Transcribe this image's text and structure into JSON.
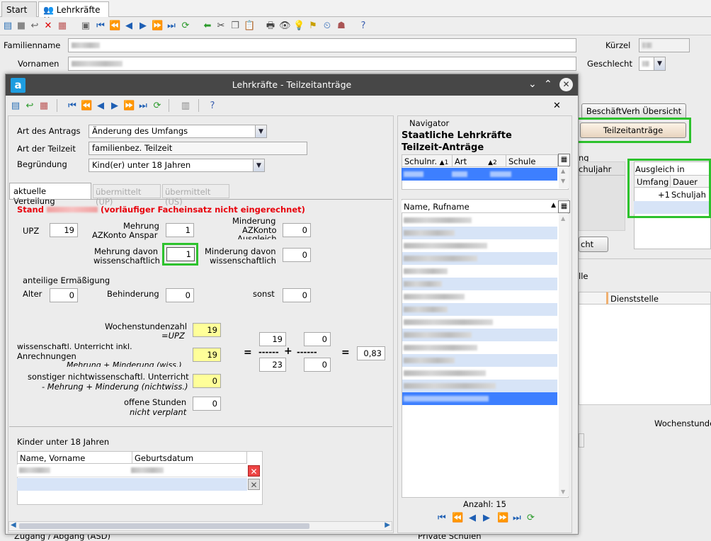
{
  "tabs": {
    "start": "Start",
    "lehrkraefte": "Lehrkräfte",
    "close": "✕"
  },
  "main": {
    "familienname_label": "Familienname",
    "vornamen_label": "Vornamen",
    "kuerzel_label": "Kürzel",
    "geschlecht_label": "Geschlecht",
    "beschaeft_button": "BeschäftVerh Übersicht",
    "teilzeit_button": "Teilzeitanträge",
    "ausgleich_header": "Ausgleich in diesem",
    "umfang_col": "Umfang",
    "dauer_col": "Dauer",
    "ausgleich_value": "+1",
    "ausgleich_dauer": "Schuljah",
    "schuljahr_label": "chuljahr",
    "g_label": "ng",
    "cht_button": "cht",
    "lle_label": "lle",
    "dienststelle_col": "Dienststelle",
    "wochenstunden_label": "Wochenstunde",
    "zugang_label": "Zugang / Abgang (ASD)",
    "private_label": "Private Schulen"
  },
  "dialog": {
    "title": "Lehrkräfte - Teilzeitanträge",
    "logo": "a",
    "art_antrag_label": "Art des Antrags",
    "art_antrag_value": "Änderung des Umfangs",
    "art_teilzeit_label": "Art der Teilzeit",
    "art_teilzeit_value": "familienbez. Teilzeit",
    "begruendung_label": "Begründung",
    "begruendung_value": "Kind(er) unter 18 Jahren",
    "tab_aktuell": "aktuelle Verteilung",
    "tab_up": "übermittelt (UP)",
    "tab_us": "übermittelt (US)",
    "stand_label": "Stand",
    "stand_note": "(vorläufiger Facheinsatz nicht eingerechnet)",
    "upz_label": "UPZ",
    "upz_value": "19",
    "mehrung_azkonto_label1": "Mehrung",
    "mehrung_azkonto_label2": "AZKonto Anspar",
    "mehrung_azkonto_value": "1",
    "minderung_azkonto_label1": "Minderung",
    "minderung_azkonto_label2": "AZKonto",
    "minderung_azkonto_label3": "Ausgleich",
    "minderung_azkonto_value": "0",
    "mehrung_wiss_label1": "Mehrung davon",
    "mehrung_wiss_label2": "wissenschaftlich",
    "mehrung_wiss_value": "1",
    "minderung_wiss_label1": "Minderung davon",
    "minderung_wiss_label2": "wissenschaftlich",
    "minderung_wiss_value": "0",
    "anteilige_label": "anteilige Ermäßigung",
    "alter_label": "Alter",
    "alter_value": "0",
    "behinderung_label": "Behinderung",
    "behinderung_value": "0",
    "sonst_label": "sonst",
    "sonst_value": "0",
    "wochenstunden_label": "Wochenstundenzahl",
    "wochenstunden_sub": "=UPZ",
    "wochenstunden_value": "19",
    "wiss_unterricht_label1": "wissenschaftl. Unterricht inkl.",
    "wiss_unterricht_label2": "Anrechnungen",
    "wiss_unterricht_label3": "Mehrung + Minderung (wiss.)",
    "wiss_unterricht_value": "19",
    "sonst_unterricht_label1": "sonstiger nichtwissenschaftl. Unterricht",
    "sonst_unterricht_label2": "- Mehrung + Minderung (nichtwiss.)",
    "sonst_unterricht_value": "0",
    "offene_label1": "offene Stunden",
    "offene_label2": "nicht verplant",
    "offene_value": "0",
    "calc_top1": "19",
    "calc_top2": "0",
    "calc_bottom1": "23",
    "calc_bottom2": "0",
    "calc_result": "0,83",
    "calc_eq": "=",
    "calc_dash": "------",
    "calc_plus": "+",
    "calc_eq2": "=",
    "kinder_label": "Kinder unter 18 Jahren",
    "kinder_col1": "Name, Vorname",
    "kinder_col2": "Geburtsdatum",
    "navigator_label": "Navigator",
    "nav_title1": "Staatliche Lehrkräfte",
    "nav_title2": "Teilzeit-Anträge",
    "nav_col_schulnr": "Schulnr.",
    "nav_col_art": "Art",
    "nav_col_schule": "Schule",
    "sort1": "▲1",
    "sort2": "▲2",
    "name_col": "Name, Rufname",
    "anzahl": "Anzahl: 15"
  },
  "colors": {
    "accent_green": "#2dc22d",
    "selection": "#3d7fff",
    "stand_red": "#e8000b",
    "yellow": "#ffff99"
  },
  "icons": [
    "save-icon",
    "undo-icon",
    "delete-icon",
    "first-icon",
    "prev-icon",
    "next-icon",
    "last-icon",
    "refresh-icon",
    "help-icon",
    "close-icon"
  ]
}
